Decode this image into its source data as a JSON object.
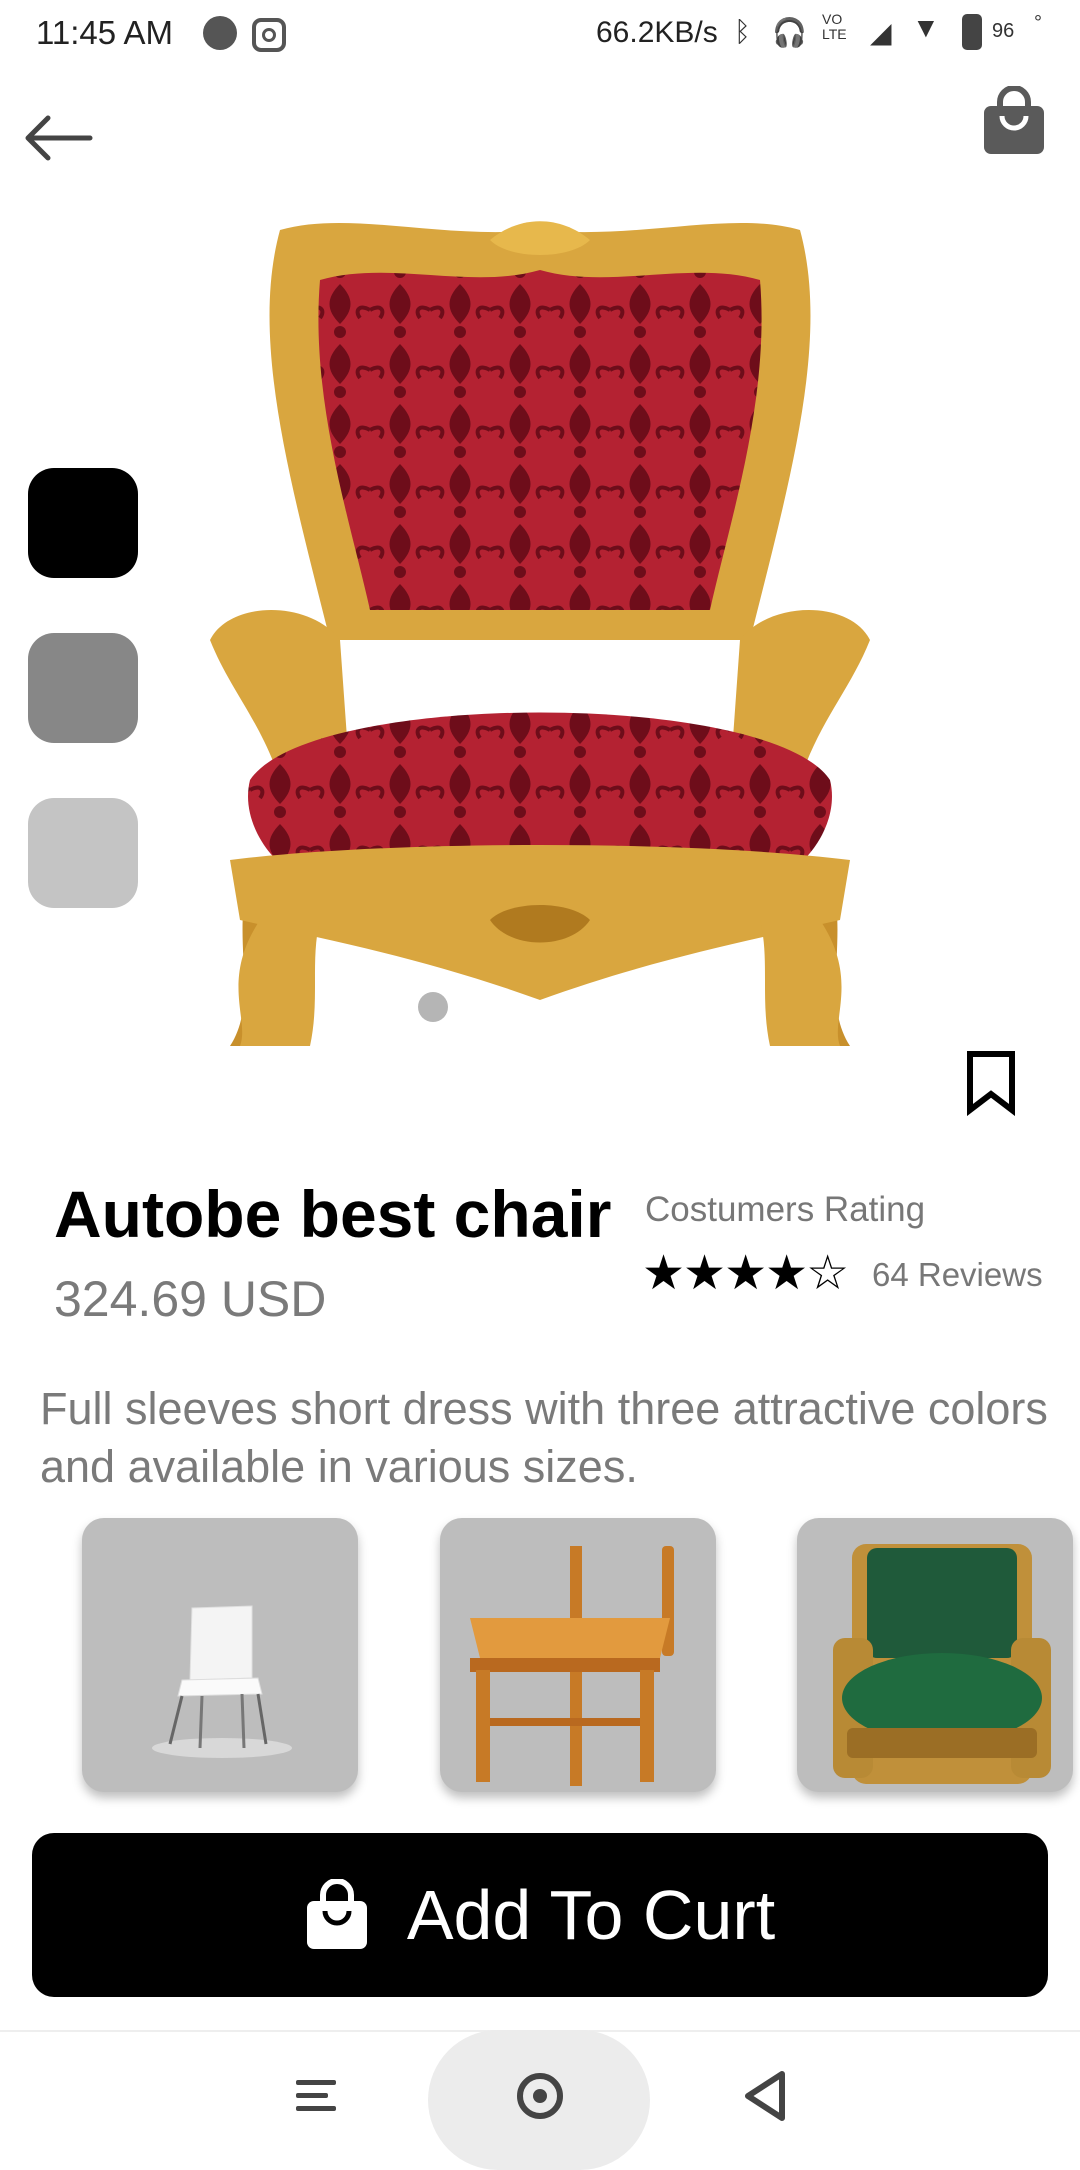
{
  "status_bar": {
    "time": "11:45 AM",
    "net_speed": "66.2KB/s",
    "volte": "VO\nLTE",
    "battery_pct": "96",
    "icons": [
      "whatsapp-icon",
      "instagram-icon",
      "bluetooth-icon",
      "headphones-icon",
      "signal-icon",
      "wifi-icon",
      "battery-icon"
    ]
  },
  "product": {
    "title": "Autobe best chair",
    "price": "324.69 USD",
    "rating_label": "Costumers Rating",
    "rating": 4,
    "rating_max": 5,
    "stars": "★★★★☆",
    "reviews": "64 Reviews",
    "description": "Full sleeves short dress with three attractive colors and available in various sizes."
  },
  "swatches": [
    {
      "name": "black",
      "color": "#000000"
    },
    {
      "name": "gray",
      "color": "#878787"
    },
    {
      "name": "light-gray",
      "color": "#c4c4c4"
    }
  ],
  "carousel": {
    "active_index": 0
  },
  "cta": {
    "label": "Add To Curt"
  },
  "colors": {
    "accent": "#000000",
    "card_bg": "#bdbdbd",
    "price_text": "#7a7a7a",
    "throne_gold": "#d2a23a",
    "throne_velvet": "#a81a2a",
    "throne_green": "#1f5a3a"
  }
}
